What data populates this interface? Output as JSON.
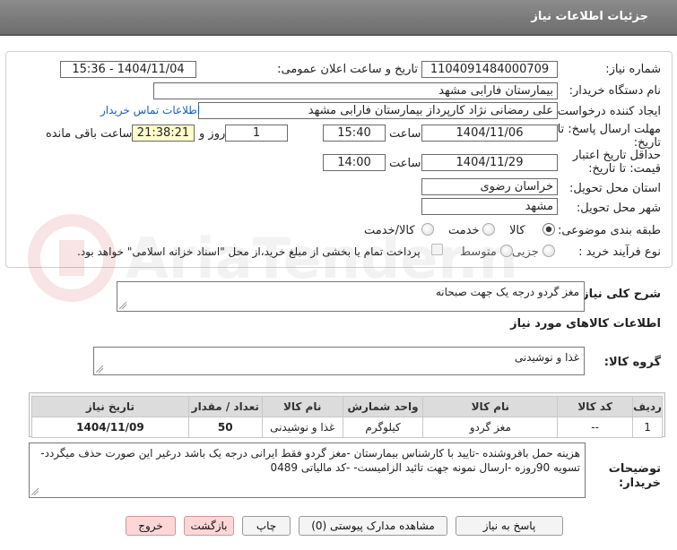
{
  "header": {
    "title": "جزئیات اطلاعات نیاز"
  },
  "form": {
    "need_number": {
      "label": "شماره نیاز:",
      "value": "1104091484000709"
    },
    "announce_datetime": {
      "label": "تاریخ و ساعت اعلان عمومی:",
      "value": "1404/11/04 - 15:36"
    },
    "buyer_org": {
      "label": "نام دستگاه خریدار:",
      "value": "بیمارستان فارابی مشهد"
    },
    "requester": {
      "label": "ایجاد کننده درخواست:",
      "value": "علی رمضانی نژاد کارپرداز بیمارستان فارابی مشهد",
      "contact_link": "اطلاعات تماس خریدار"
    },
    "reply_deadline": {
      "label_line1": "مهلت ارسال پاسخ: تا",
      "label_line2": "تاریخ:",
      "date": "1404/11/06",
      "time_label": "ساعت",
      "time": "15:40",
      "days": "1",
      "days_label": "روز و",
      "remaining": "21:38:21",
      "remaining_label": "ساعت باقی مانده"
    },
    "price_validity": {
      "label_line1": "حداقل تاریخ اعتبار",
      "label_line2": "قیمت: تا تاریخ:",
      "date": "1404/11/29",
      "time_label": "ساعت",
      "time": "14:00"
    },
    "province": {
      "label": "استان محل تحویل:",
      "value": "خراسان رضوی"
    },
    "city": {
      "label": "شهر محل تحویل:",
      "value": "مشهد"
    },
    "category": {
      "label": "طبقه بندی موضوعی:",
      "options": [
        "کالا",
        "خدمت",
        "کالا/خدمت"
      ],
      "selected": "کالا"
    },
    "purchase_type": {
      "label": "نوع فرآیند خرید :",
      "options": [
        "جزیی",
        "متوسط"
      ],
      "selected": "",
      "note": "پرداخت تمام یا بخشی از مبلغ خرید،از محل \"اسناد خزانه اسلامی\" خواهد بود."
    }
  },
  "description": {
    "label": "شرح کلی نیاز:",
    "value": "مغز گردو درجه یک جهت صبحانه"
  },
  "goods_info": {
    "title": "اطلاعات کالاهای مورد نیاز"
  },
  "goods_group": {
    "label": "گروه کالا:",
    "value": "غذا و نوشیدنی"
  },
  "table": {
    "headers": [
      "ردیف",
      "کد کالا",
      "نام کالا",
      "واحد شمارش",
      "نام کالا",
      "تعداد / مقدار",
      "تاریخ نیاز"
    ],
    "rows": [
      [
        "1",
        "--",
        "مغز گردو",
        "کیلوگرم",
        "غذا و نوشیدنی",
        "50",
        "1404/11/09"
      ]
    ]
  },
  "buyer_notes": {
    "label_line1": "توضیحات",
    "label_line2": "خریدار:",
    "value": "هزینه حمل بافروشنده -تایید با کارشناس بیمارستان -مغز گردو فقط ایرانی درجه یک باشد درغیر این صورت حذف میگردد-تسویه 90روزه -ارسال نمونه جهت تائید الزامیست- -کد مالیاتی 0489"
  },
  "buttons": {
    "reply": "پاسخ به نیاز",
    "view_docs": "مشاهده مدارک پیوستی (0)",
    "print": "چاپ",
    "back": "بازگشت",
    "exit": "خروج"
  },
  "watermark": {
    "text": "AriaTender.neT"
  }
}
